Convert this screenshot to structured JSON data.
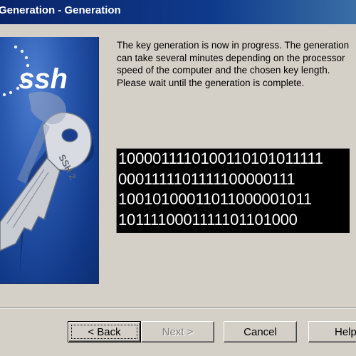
{
  "window": {
    "title": "Generation - Generation"
  },
  "wizard_art": {
    "logo_text": "ssh",
    "key_engraving": "SSH 2",
    "colors": {
      "background": "#2a59b0",
      "key": "#c9ccd3"
    }
  },
  "instructions": {
    "text": "The key generation is now in progress. The generation can take several minutes depending on the processor speed of the computer and the chosen key length. Please wait until the generation is complete."
  },
  "progress_display": {
    "lines": [
      "1000011110100110101011111",
      "0001111101111100000111",
      "10010100011011000001011",
      "1011110001111101101000"
    ]
  },
  "buttons": {
    "back": "< Back",
    "next": "Next >",
    "cancel": "Cancel",
    "help": "Help"
  }
}
